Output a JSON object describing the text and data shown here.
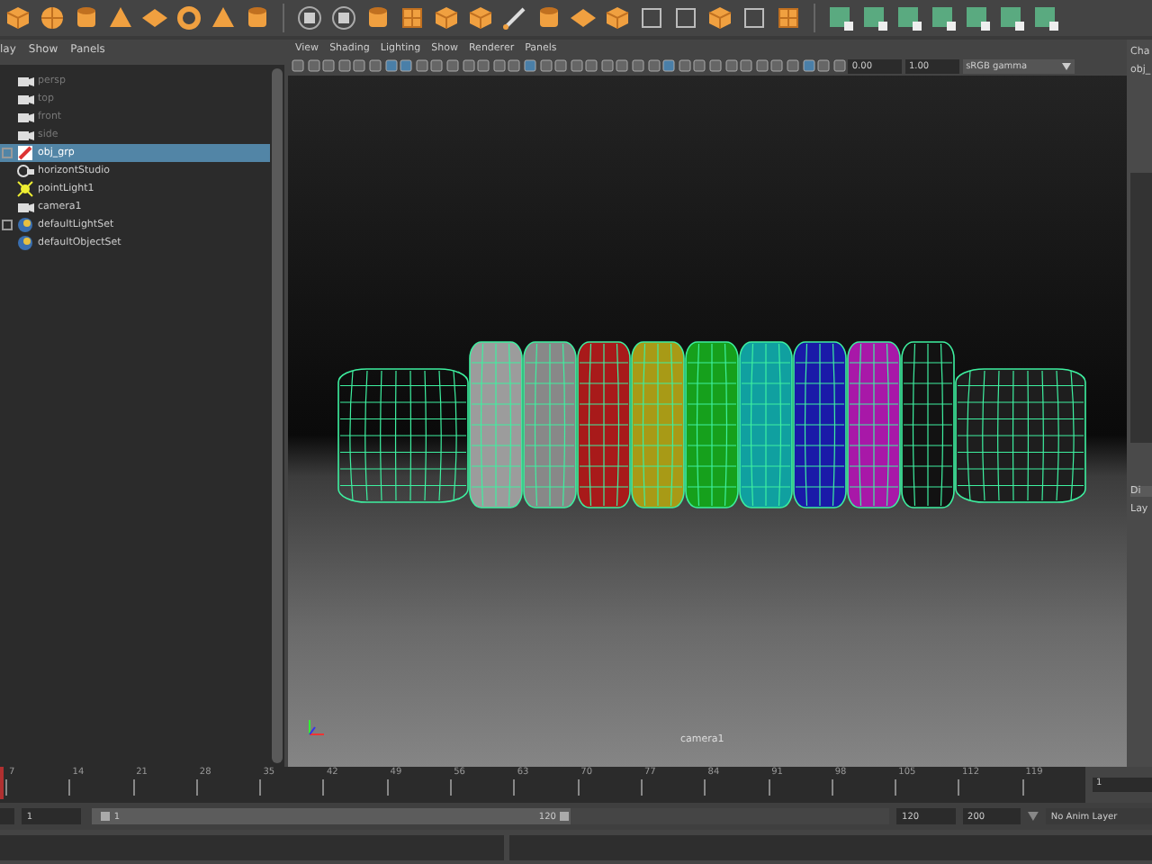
{
  "outliner": {
    "menu": [
      "lay",
      "Show",
      "Panels"
    ],
    "items": [
      {
        "label": "persp",
        "kind": "camera",
        "dimmed": true,
        "selected": false,
        "expandable": false
      },
      {
        "label": "top",
        "kind": "camera",
        "dimmed": true,
        "selected": false,
        "expandable": false
      },
      {
        "label": "front",
        "kind": "camera",
        "dimmed": true,
        "selected": false,
        "expandable": false
      },
      {
        "label": "side",
        "kind": "camera",
        "dimmed": true,
        "selected": false,
        "expandable": false
      },
      {
        "label": "obj_grp",
        "kind": "group",
        "dimmed": false,
        "selected": true,
        "expandable": true
      },
      {
        "label": "horizontStudio",
        "kind": "studio",
        "dimmed": false,
        "selected": false,
        "expandable": false
      },
      {
        "label": "pointLight1",
        "kind": "light",
        "dimmed": false,
        "selected": false,
        "expandable": false
      },
      {
        "label": "camera1",
        "kind": "camera",
        "dimmed": false,
        "selected": false,
        "expandable": false
      },
      {
        "label": "defaultLightSet",
        "kind": "set",
        "dimmed": false,
        "selected": false,
        "expandable": true
      },
      {
        "label": "defaultObjectSet",
        "kind": "set",
        "dimmed": false,
        "selected": false,
        "expandable": false
      }
    ]
  },
  "viewport": {
    "menu": [
      "View",
      "Shading",
      "Lighting",
      "Show",
      "Renderer",
      "Panels"
    ],
    "exposure": "0.00",
    "gamma": "1.00",
    "color_space": "sRGB gamma",
    "camera_label": "camera1",
    "objects": [
      {
        "kind": "barrel",
        "shaded": false
      },
      {
        "kind": "tire",
        "shaded": true,
        "color": "#9c9c9c"
      },
      {
        "kind": "tire",
        "shaded": true,
        "color": "#888888"
      },
      {
        "kind": "tire",
        "shaded": true,
        "color": "#a81a1a"
      },
      {
        "kind": "tire",
        "shaded": true,
        "color": "#a89a16"
      },
      {
        "kind": "tire",
        "shaded": true,
        "color": "#16a01c"
      },
      {
        "kind": "tire",
        "shaded": true,
        "color": "#10a0a0"
      },
      {
        "kind": "tire",
        "shaded": true,
        "color": "#1a1aa8"
      },
      {
        "kind": "tire",
        "shaded": true,
        "color": "#a818a8"
      },
      {
        "kind": "tire",
        "shaded": true,
        "color": "#121212"
      },
      {
        "kind": "barrel",
        "shaded": true,
        "color": "#1e1e1e"
      }
    ]
  },
  "side_panel": {
    "labels": [
      "Cha",
      "obj_"
    ],
    "tab": "Di",
    "layers_label": "Lay"
  },
  "timeline": {
    "ticks": [
      "7",
      "14",
      "21",
      "28",
      "35",
      "42",
      "49",
      "56",
      "63",
      "70",
      "77",
      "84",
      "91",
      "98",
      "105",
      "112",
      "119"
    ],
    "current_frame": "1",
    "level": 0
  },
  "range": {
    "level": 0.6,
    "start_field": "1",
    "slider_start": "1",
    "slider_end": "120",
    "end_field": "120",
    "max_field": "200",
    "anim_layer": "No Anim Layer"
  }
}
